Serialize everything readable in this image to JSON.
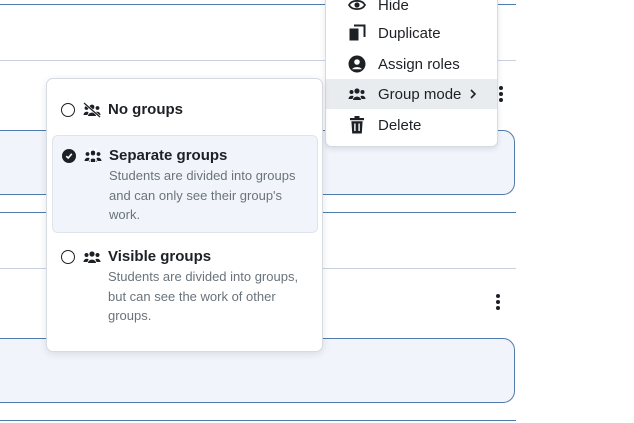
{
  "action_menu": {
    "items": [
      {
        "label": "Hide",
        "icon": "eye-icon"
      },
      {
        "label": "Duplicate",
        "icon": "copy-icon"
      },
      {
        "label": "Assign roles",
        "icon": "user-circle-icon"
      },
      {
        "label": "Group mode",
        "icon": "users-icon",
        "has_submenu": true
      },
      {
        "label": "Delete",
        "icon": "trash-icon"
      }
    ]
  },
  "group_mode_menu": {
    "options": [
      {
        "title": "No groups",
        "description": "",
        "selected": false,
        "icon": "no-groups-icon"
      },
      {
        "title": "Separate groups",
        "description": "Students are divided into groups and can only see their group's work.",
        "selected": true,
        "icon": "separate-groups-icon"
      },
      {
        "title": "Visible groups",
        "description": "Students are divided into groups, but can see the work of other groups.",
        "selected": false,
        "icon": "visible-groups-icon"
      }
    ]
  },
  "colors": {
    "accent_border": "#4f7cac",
    "selected_bg": "#f1f5fb",
    "text": "#1d2125",
    "muted_text": "#6a737b"
  }
}
